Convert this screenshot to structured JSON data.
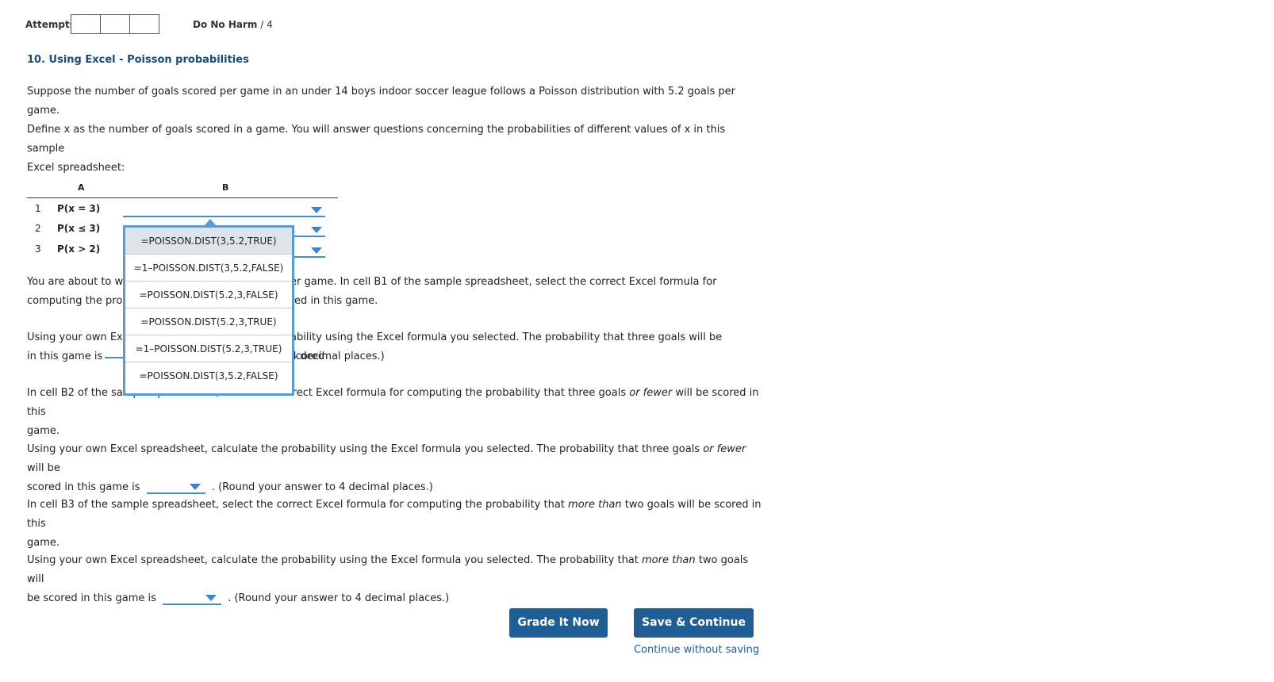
{
  "header": {
    "attempts_label": "Attempts",
    "harm_label": "Do No Harm",
    "harm_sep": "/",
    "harm_value": "4"
  },
  "question": {
    "title": "10. Using Excel - Poisson probabilities",
    "intro_1": "Suppose the number of goals scored per game in an under 14 boys indoor soccer league follows a Poisson distribution with 5.2 goals per game.",
    "intro_2": "Define x as the number of goals scored in a game. You will answer questions concerning the probabilities of different values of x in this sample",
    "intro_3": "Excel spreadsheet:"
  },
  "sheet": {
    "col_a": "A",
    "col_b": "B",
    "rows": [
      {
        "num": "1",
        "label": "P(x = 3)"
      },
      {
        "num": "2",
        "label": "P(x ≤ 3)"
      },
      {
        "num": "3",
        "label": "P(x > 2)"
      }
    ]
  },
  "dropdown": {
    "options": [
      "=POISSON.DIST(3,5.2,TRUE)",
      "=1–POISSON.DIST(3,5.2,FALSE)",
      "=POISSON.DIST(5.2,3,FALSE)",
      "=POISSON.DIST(5.2,3,TRUE)",
      "=1–POISSON.DIST(5.2,3,TRUE)",
      "=POISSON.DIST(3,5.2,FALSE)"
    ],
    "highlighted_index": 0
  },
  "paras": {
    "p1a_left": "You are about to w",
    "p1a_right": "er game. In cell B1 of the sample spreadsheet, select the correct Excel formula for",
    "p1b_left": "computing the prob",
    "p1b_right": "red in this game.",
    "p2a_left": "Using your own Exc",
    "p2a_right": "ability using the Excel formula you selected. The probability that three goals will be scored",
    "p2b_left": "in this game is",
    "p2b_right": "4 decimal places.)",
    "p3_a": "In cell B2 of the sample spreadsheet, select the correct Excel formula for computing the probability that three goals ",
    "p3_em": "or fewer",
    "p3_b": " will be scored in this",
    "p3_c": "game.",
    "p4_a": "Using your own Excel spreadsheet, calculate the probability using the Excel formula you selected. The probability that three goals ",
    "p4_em": "or fewer",
    "p4_b": " will be",
    "p4_c": "scored in this game is",
    "p4_d": ". (Round your answer to 4 decimal places.)",
    "p5_a": "In cell B3 of the sample spreadsheet, select the correct Excel formula for computing the probability that ",
    "p5_em": "more than",
    "p5_b": " two goals will be scored in this",
    "p5_c": "game.",
    "p6_a": "Using your own Excel spreadsheet, calculate the probability using the Excel formula you selected. The probability that ",
    "p6_em": "more than",
    "p6_b": " two goals will",
    "p6_c": "be scored in this game is",
    "p6_d": ". (Round your answer to 4 decimal places.)"
  },
  "actions": {
    "grade": "Grade It Now",
    "save": "Save & Continue",
    "continue": "Continue without saving"
  }
}
